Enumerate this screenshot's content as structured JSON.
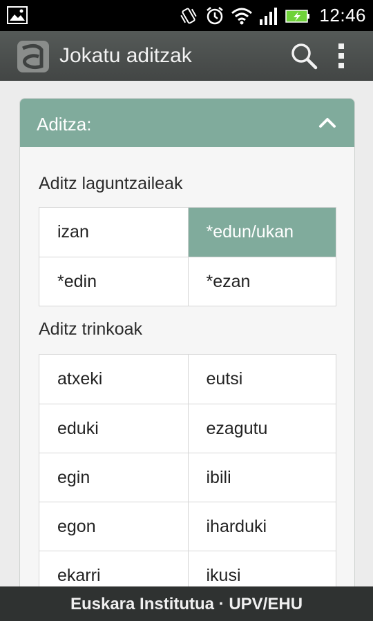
{
  "status_bar": {
    "time": "12:46",
    "icons": [
      "gallery-icon",
      "vibrate-icon",
      "alarm-icon",
      "wifi-icon",
      "signal-icon",
      "battery-charging-icon"
    ]
  },
  "action_bar": {
    "title": "Jokatu aditzak",
    "logo": "app-logo-icon",
    "actions": [
      "search-icon",
      "overflow-menu-icon"
    ]
  },
  "panel": {
    "header": "Aditza:",
    "expanded": true,
    "sections": [
      {
        "title": "Aditz laguntzaileak",
        "rows": [
          [
            {
              "label": "izan",
              "selected": false
            },
            {
              "label": "*edun/ukan",
              "selected": true
            }
          ],
          [
            {
              "label": "*edin",
              "selected": false
            },
            {
              "label": "*ezan",
              "selected": false
            }
          ]
        ]
      },
      {
        "title": "Aditz trinkoak",
        "rows": [
          [
            {
              "label": "atxeki"
            },
            {
              "label": "eutsi"
            }
          ],
          [
            {
              "label": "eduki"
            },
            {
              "label": "ezagutu"
            }
          ],
          [
            {
              "label": "egin"
            },
            {
              "label": "ibili"
            }
          ],
          [
            {
              "label": "egon"
            },
            {
              "label": "iharduki"
            }
          ],
          [
            {
              "label": "ekarri"
            },
            {
              "label": "ikusi"
            }
          ]
        ]
      }
    ]
  },
  "footer": {
    "text": "Euskara Institutua · UPV/EHU"
  },
  "colors": {
    "accent": "#80ab9c",
    "action_bar": "#4a4d4c",
    "footer": "#2f3231",
    "battery": "#6fd23a"
  }
}
